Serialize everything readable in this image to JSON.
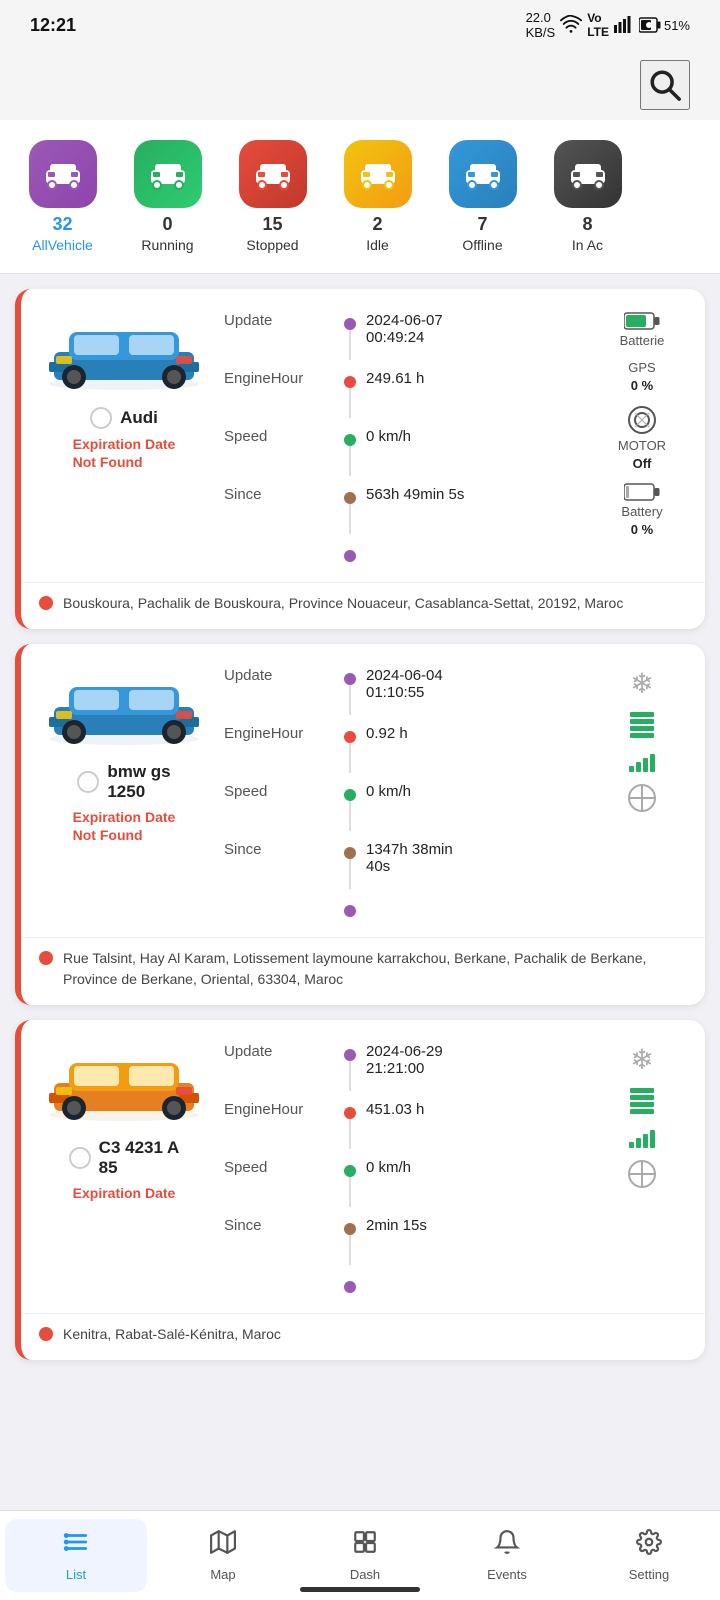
{
  "statusBar": {
    "time": "12:21",
    "battery": "51%",
    "signal": "22.0 KB/S"
  },
  "categories": [
    {
      "id": "all",
      "count": "32",
      "label": "AllVehicle",
      "colorClass": "cat-all",
      "active": true
    },
    {
      "id": "running",
      "count": "0",
      "label": "Running",
      "colorClass": "cat-running",
      "active": false
    },
    {
      "id": "stopped",
      "count": "15",
      "label": "Stopped",
      "colorClass": "cat-stopped",
      "active": false
    },
    {
      "id": "idle",
      "count": "2",
      "label": "Idle",
      "colorClass": "cat-idle",
      "active": false
    },
    {
      "id": "offline",
      "count": "7",
      "label": "Offline",
      "colorClass": "cat-offline",
      "active": false
    },
    {
      "id": "inac",
      "count": "8",
      "label": "In Ac",
      "colorClass": "cat-inac",
      "active": false
    }
  ],
  "vehicles": [
    {
      "id": "audi",
      "name": "Audi",
      "color": "blue",
      "expiry": "Expiration Date\nNot Found",
      "update": "2024-06-07\n00:49:24",
      "engineHour": "249.61 h",
      "speed": "0 km/h",
      "since": "563h 49min 5s",
      "batterie": "Batterie",
      "gps": "GPS\n0 %",
      "motor": "MOTOR\nOff",
      "battery": "Battery\n0 %",
      "location": "Bouskoura, Pachalik de Bouskoura, Province Nouaceur, Casablanca-Settat, 20192, Maroc",
      "dotColors": [
        "#9b59b6",
        "#e74c3c",
        "#27ae60",
        "#a0714f",
        "#9b59b6"
      ],
      "rightIcons": [
        "battery-icon",
        "gps-text",
        "motor-icon",
        "battery2-icon"
      ]
    },
    {
      "id": "bmwgs1250",
      "name": "bmw gs\n1250",
      "color": "blue",
      "expiry": "Expiration Date\nNot Found",
      "update": "2024-06-04\n01:10:55",
      "engineHour": "0.92 h",
      "speed": "0 km/h",
      "since": "1347h 38min\n40s",
      "location": "Rue Talsint, Hay Al Karam, Lotissement laymoune karrakchou, Berkane, Pachalik de Berkane, Province de Berkane, Oriental, 63304, Maroc",
      "dotColors": [
        "#9b59b6",
        "#e74c3c",
        "#27ae60",
        "#a0714f",
        "#9b59b6"
      ],
      "rightIcons": [
        "snow-icon",
        "green-battery",
        "signal-bars",
        "crosshair"
      ]
    },
    {
      "id": "c34231a85",
      "name": "C3 4231 A\n85",
      "color": "yellow",
      "expiry": "Expiration Date",
      "update": "2024-06-29\n21:21:00",
      "engineHour": "451.03 h",
      "speed": "0 km/h",
      "since": "2min 15s",
      "location": "Kenitra, Rabat-Salé-Kénitra, Maroc",
      "dotColors": [
        "#9b59b6",
        "#e74c3c",
        "#27ae60",
        "#a0714f",
        "#9b59b6"
      ],
      "rightIcons": [
        "snow-icon",
        "green-battery",
        "signal-bars",
        "crosshair"
      ]
    }
  ],
  "bottomNav": [
    {
      "id": "list",
      "label": "List",
      "active": true
    },
    {
      "id": "map",
      "label": "Map",
      "active": false
    },
    {
      "id": "dash",
      "label": "Dash",
      "active": false
    },
    {
      "id": "events",
      "label": "Events",
      "active": false
    },
    {
      "id": "setting",
      "label": "Setting",
      "active": false
    }
  ]
}
